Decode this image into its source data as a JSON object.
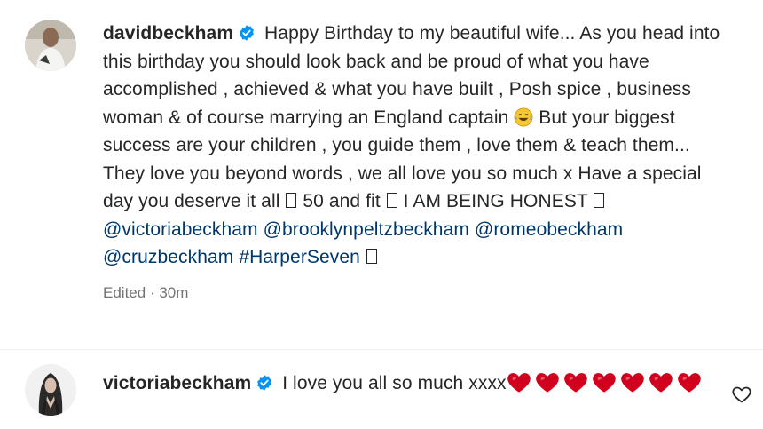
{
  "post": {
    "username": "davidbeckham",
    "verified_icon": "verified-badge-icon",
    "caption_part1": "Happy Birthday to my beautiful wife... As you head into this birthday you should look back and be proud of what you have accomplished , achieved & what you have built , Posh spice , business woman & of course marrying an England captain",
    "emoji_laugh": "tears-of-joy-emoji",
    "caption_part2": "But your biggest success are your children , you guide them , love them & teach them... They love you beyond words , we all love you so much x Have a special day you deserve it all",
    "caption_part3": "50 and fit",
    "caption_part4": "I AM BEING HONEST",
    "mentions": [
      "@victoriabeckham",
      "@brooklynpeltzbeckham",
      "@romeobeckham",
      "@cruzbeckham"
    ],
    "hashtag": "#HarperSeven",
    "edited_label": "Edited",
    "separator": "·",
    "time": "30m"
  },
  "comment": {
    "username": "victoriabeckham",
    "verified_icon": "verified-badge-icon",
    "text": "I love you all so much xxxx",
    "heart_count": 7,
    "heart_color": "#d1001f",
    "like_icon": "heart-outline-icon"
  },
  "colors": {
    "text": "#262626",
    "verified_blue": "#0095f6",
    "meta_gray": "#737373"
  }
}
